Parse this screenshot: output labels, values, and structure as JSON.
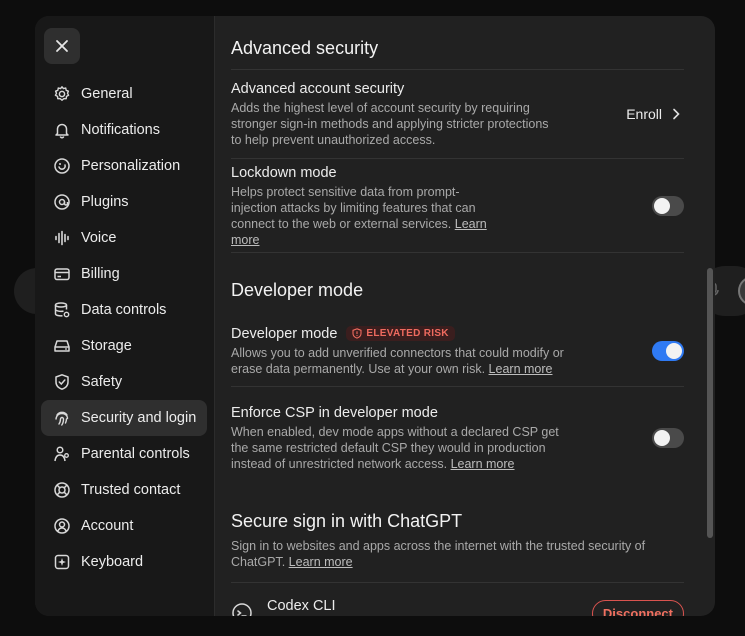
{
  "sidebar": {
    "items": [
      {
        "label": "General",
        "icon": "gear-icon"
      },
      {
        "label": "Notifications",
        "icon": "bell-icon"
      },
      {
        "label": "Personalization",
        "icon": "personalization-icon"
      },
      {
        "label": "Plugins",
        "icon": "plugins-icon"
      },
      {
        "label": "Voice",
        "icon": "voice-icon"
      },
      {
        "label": "Billing",
        "icon": "card-icon"
      },
      {
        "label": "Data controls",
        "icon": "database-icon"
      },
      {
        "label": "Storage",
        "icon": "storage-icon"
      },
      {
        "label": "Safety",
        "icon": "shield-icon"
      },
      {
        "label": "Security and login",
        "icon": "fingerprint-icon"
      },
      {
        "label": "Parental controls",
        "icon": "parent-icon"
      },
      {
        "label": "Trusted contact",
        "icon": "lifebuoy-icon"
      },
      {
        "label": "Account",
        "icon": "user-circle-icon"
      },
      {
        "label": "Keyboard",
        "icon": "keyboard-icon"
      }
    ],
    "active_index": 9
  },
  "advanced_security": {
    "title": "Advanced security",
    "account_security": {
      "title": "Advanced account security",
      "description": "Adds the highest level of account security by requiring stronger sign-in methods and applying stricter protections to help prevent unauthorized access.",
      "action": "Enroll"
    },
    "lockdown": {
      "title": "Lockdown mode",
      "description": "Helps protect sensitive data from prompt-injection attacks by limiting features that can connect to the web or external services.",
      "link": "Learn more",
      "enabled": false
    }
  },
  "developer_mode": {
    "title": "Developer mode",
    "dev": {
      "title": "Developer mode",
      "badge": "ELEVATED RISK",
      "description": "Allows you to add unverified connectors that could modify or erase data permanently. Use at your own risk.",
      "link": "Learn more",
      "enabled": true
    },
    "csp": {
      "title": "Enforce CSP in developer mode",
      "description": "When enabled, dev mode apps without a declared CSP get the same restricted default CSP they would in production instead of unrestricted network access.",
      "link": "Learn more",
      "enabled": false
    }
  },
  "secure_signin": {
    "title": "Secure sign in with ChatGPT",
    "description": "Sign in to websites and apps across the internet with the trusted security of ChatGPT.",
    "link": "Learn more",
    "app": {
      "name": "Codex CLI",
      "action": "Disconnect"
    }
  },
  "colors": {
    "accent": "#2f7af3",
    "danger": "#ef6b5f",
    "background": "#212121"
  }
}
